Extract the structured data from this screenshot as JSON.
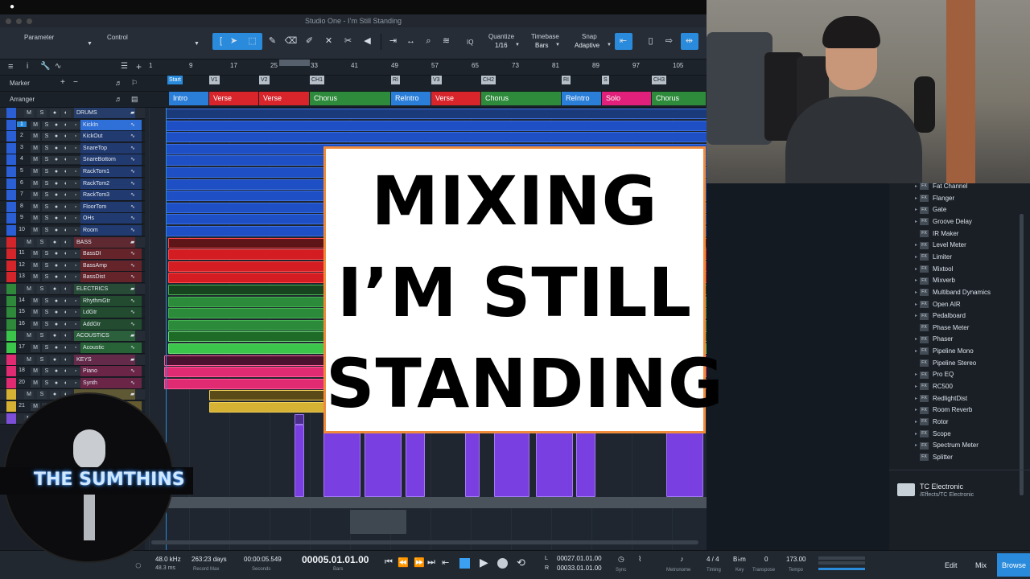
{
  "window": {
    "title": "Studio One - I’m Still Standing"
  },
  "toolbar": {
    "parameter_label": "Parameter",
    "control_label": "Control",
    "iq_label": "IQ",
    "quantize_label": "Quantize",
    "quantize_value": "1/16",
    "timebase_label": "Timebase",
    "timebase_value": "Bars",
    "snap_label": "Snap",
    "snap_value": "Adaptive"
  },
  "ruler": {
    "numbers": [
      "1",
      "9",
      "17",
      "25",
      "33",
      "41",
      "49",
      "57",
      "65",
      "73",
      "81",
      "89",
      "97",
      "105"
    ]
  },
  "rows": {
    "marker_label": "Marker",
    "arranger_label": "Arranger"
  },
  "markers": [
    "Start",
    "V1",
    "V2",
    "CH1",
    "RI",
    "V3",
    "CH2",
    "RI",
    "S",
    "CH3"
  ],
  "arranger": [
    {
      "label": "Intro",
      "color": "#2a7ed8"
    },
    {
      "label": "Verse",
      "color": "#d8242b"
    },
    {
      "label": "Verse",
      "color": "#d8242b"
    },
    {
      "label": "Chorus",
      "color": "#2e8b3c"
    },
    {
      "label": "ReIntro",
      "color": "#2a7ed8"
    },
    {
      "label": "Verse",
      "color": "#d8242b"
    },
    {
      "label": "Chorus",
      "color": "#2e8b3c"
    },
    {
      "label": "ReIntro",
      "color": "#2a7ed8"
    },
    {
      "label": "Solo",
      "color": "#e0207a"
    },
    {
      "label": "Chorus",
      "color": "#2e8b3c"
    }
  ],
  "tracks": [
    {
      "num": "",
      "name": "DRUMS",
      "folder": true,
      "color": "#2a5fd6"
    },
    {
      "num": "1",
      "name": "KickIn",
      "color": "#2a5fd6",
      "selected": true
    },
    {
      "num": "2",
      "name": "KickOut",
      "color": "#2a5fd6"
    },
    {
      "num": "3",
      "name": "SnareTop",
      "color": "#2a5fd6"
    },
    {
      "num": "4",
      "name": "SnareBottom",
      "color": "#2a5fd6"
    },
    {
      "num": "5",
      "name": "RackTom1",
      "color": "#2a5fd6"
    },
    {
      "num": "6",
      "name": "RackTom2",
      "color": "#2a5fd6"
    },
    {
      "num": "7",
      "name": "RackTom3",
      "color": "#2a5fd6"
    },
    {
      "num": "8",
      "name": "FloorTom",
      "color": "#2a5fd6"
    },
    {
      "num": "9",
      "name": "OHs",
      "color": "#2a5fd6"
    },
    {
      "num": "10",
      "name": "Room",
      "color": "#2a5fd6"
    },
    {
      "num": "",
      "name": "BASS",
      "folder": true,
      "color": "#d4252b"
    },
    {
      "num": "11",
      "name": "BassDI",
      "color": "#d4252b"
    },
    {
      "num": "12",
      "name": "BassAmp",
      "color": "#d4252b"
    },
    {
      "num": "13",
      "name": "BassDist",
      "color": "#d4252b"
    },
    {
      "num": "",
      "name": "ELECTRICS",
      "folder": true,
      "color": "#2e8a3a"
    },
    {
      "num": "14",
      "name": "RhythmGtr",
      "color": "#2e8a3a"
    },
    {
      "num": "15",
      "name": "LdGtr",
      "color": "#2e8a3a"
    },
    {
      "num": "16",
      "name": "AddGtr",
      "color": "#2e8a3a"
    },
    {
      "num": "",
      "name": "ACOUSTICS",
      "folder": true,
      "color": "#3bc54a"
    },
    {
      "num": "17",
      "name": "Acoustic",
      "color": "#3bc54a"
    },
    {
      "num": "",
      "name": "KEYS",
      "folder": true,
      "color": "#e02a72"
    },
    {
      "num": "18",
      "name": "Piano",
      "color": "#e02a72"
    },
    {
      "num": "20",
      "name": "Synth",
      "color": "#e02a72"
    },
    {
      "num": "",
      "name": "",
      "folder": true,
      "color": "#d6b234"
    },
    {
      "num": "21",
      "name": "",
      "color": "#d6b234"
    },
    {
      "num": "",
      "name": "",
      "folder": true,
      "color": "#7d4fd8"
    }
  ],
  "overlay": {
    "line1": "MIXING",
    "line2": "I’M STILL",
    "line3": "STANDING"
  },
  "browser": {
    "items": [
      {
        "label": "Fat Channel",
        "expand": true
      },
      {
        "label": "Flanger",
        "expand": true
      },
      {
        "label": "Gate",
        "expand": true
      },
      {
        "label": "Groove Delay",
        "expand": true
      },
      {
        "label": "IR Maker",
        "expand": false
      },
      {
        "label": "Level Meter",
        "expand": true
      },
      {
        "label": "Limiter",
        "expand": true
      },
      {
        "label": "Mixtool",
        "expand": true
      },
      {
        "label": "Mixverb",
        "expand": true
      },
      {
        "label": "Multiband Dynamics",
        "expand": true
      },
      {
        "label": "Open AIR",
        "expand": true
      },
      {
        "label": "Pedalboard",
        "expand": true
      },
      {
        "label": "Phase Meter",
        "expand": false
      },
      {
        "label": "Phaser",
        "expand": true
      },
      {
        "label": "Pipeline Mono",
        "expand": true
      },
      {
        "label": "Pipeline Stereo",
        "expand": false
      },
      {
        "label": "Pro EQ",
        "expand": true
      },
      {
        "label": "RC500",
        "expand": true
      },
      {
        "label": "RedlightDist",
        "expand": true
      },
      {
        "label": "Room Reverb",
        "expand": true
      },
      {
        "label": "Rotor",
        "expand": true
      },
      {
        "label": "Scope",
        "expand": true
      },
      {
        "label": "Spectrum Meter",
        "expand": true
      },
      {
        "label": "Splitter",
        "expand": false
      }
    ],
    "fx_badge": "FX",
    "folder_name": "TC Electronic",
    "folder_path": "/Effects/TC Electronic"
  },
  "transport": {
    "sample_rate": "48.0 kHz",
    "latency": "48.3 ms",
    "record_max_value": "263:23 days",
    "record_max_label": "Record Max",
    "seconds_value": "00:00:05.549",
    "seconds_label": "Seconds",
    "bars_value": "00005.01.01.00",
    "bars_label": "Bars",
    "loop_l": "00027.01.01.00",
    "loop_r": "00033.01.01.00",
    "l_label": "L",
    "r_label": "R",
    "sync_label": "Sync",
    "metronome_label": "Metronome",
    "timing_value": "4 / 4",
    "timing_label": "Timing",
    "key_value": "B♭m",
    "key_label": "Key",
    "transpose_value": "0",
    "transpose_label": "Transpose",
    "tempo_value": "173.00",
    "tempo_label": "Tempo",
    "edit_button": "Edit",
    "mix_button": "Mix",
    "browse_button": "Browse"
  },
  "logo": {
    "text": "THE SUMTHINS"
  },
  "colors": {
    "accent": "#2a8bdc",
    "overlay_border": "#f08b3c",
    "clip_drums": "#1f4fc4",
    "clip_bass": "#d41d23",
    "clip_purple": "#7a3fe0"
  }
}
